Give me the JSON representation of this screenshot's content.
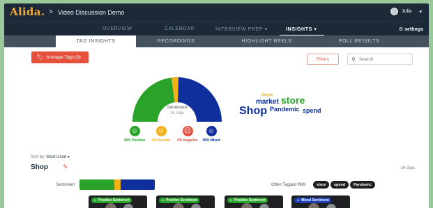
{
  "header": {
    "logo": "Alida.",
    "separator": ">",
    "app_title": "Video Discussion Demo",
    "user_name": "Julia"
  },
  "main_nav": {
    "items": [
      {
        "label": "OVERVIEW",
        "active": false
      },
      {
        "label": "CALENDAR",
        "active": false
      },
      {
        "label": "INTERVIEW PREP ▾",
        "active": false
      },
      {
        "label": "INSIGHTS ▾",
        "active": true
      }
    ],
    "settings_label": "settings"
  },
  "sub_nav": {
    "tabs": [
      {
        "label": "TAG INSIGHTS",
        "active": true
      },
      {
        "label": "RECORDINGS",
        "active": false
      },
      {
        "label": "HIGHLIGHT REELS",
        "active": false
      },
      {
        "label": "POLL RESULTS",
        "active": false
      }
    ]
  },
  "toolbar": {
    "manage_tags_label": "Manage Tags (9)",
    "filters_label": "Filters",
    "search_placeholder": "Search"
  },
  "sentiment_chart": {
    "center_title": "Sentiment",
    "center_sub": "16 clips",
    "segments": [
      {
        "name": "Positive",
        "percent": 46,
        "color": "#2aa32a"
      },
      {
        "name": "Neutral",
        "percent": 5,
        "color": "#f2b21a"
      },
      {
        "name": "Negative",
        "percent": 0,
        "color": "#e8503e"
      },
      {
        "name": "Mixed",
        "percent": 49,
        "color": "#0f2f9c"
      }
    ],
    "legend": [
      {
        "label": "46% Positive",
        "color": "#2aa32a",
        "face": "☺"
      },
      {
        "label": "0% Neutral",
        "color": "#f2b21a",
        "face": "☺"
      },
      {
        "label": "0% Negative",
        "color": "#e8503e",
        "face": "☹"
      },
      {
        "label": "49% Mixed",
        "color": "#0f2f9c",
        "face": "☺"
      }
    ]
  },
  "word_cloud": [
    {
      "text": "Single",
      "color": "#f2b21a"
    },
    {
      "text": "market",
      "color": "#0f2f9c"
    },
    {
      "text": "store",
      "color": "#2aa32a"
    },
    {
      "text": "Shop",
      "color": "#0f2f9c"
    },
    {
      "text": "Pandemic",
      "color": "#0f2f9c"
    },
    {
      "text": "spend",
      "color": "#0f2f9c"
    }
  ],
  "sort": {
    "label": "Sort by:",
    "value": "Most Used ▾"
  },
  "tag_section": {
    "title": "Shop",
    "clip_count": "16 clips",
    "sentiment_label": "Sentiment",
    "bar": [
      {
        "percent": 46,
        "color": "#2aa32a"
      },
      {
        "percent": 9,
        "color": "#f2b21a"
      },
      {
        "percent": 45,
        "color": "#0f2f9c"
      }
    ],
    "often_tagged_label": "Often Tagged With",
    "related_tags": [
      "store",
      "spend",
      "Pandemic"
    ]
  },
  "videos": [
    {
      "badge": "Positive Sentiment",
      "color": "#2aa32a"
    },
    {
      "badge": "Positive Sentiment",
      "color": "#2aa32a"
    },
    {
      "badge": "Positive Sentiment",
      "color": "#2aa32a"
    },
    {
      "badge": "Mixed Sentiment",
      "color": "#1f3fb8"
    }
  ]
}
